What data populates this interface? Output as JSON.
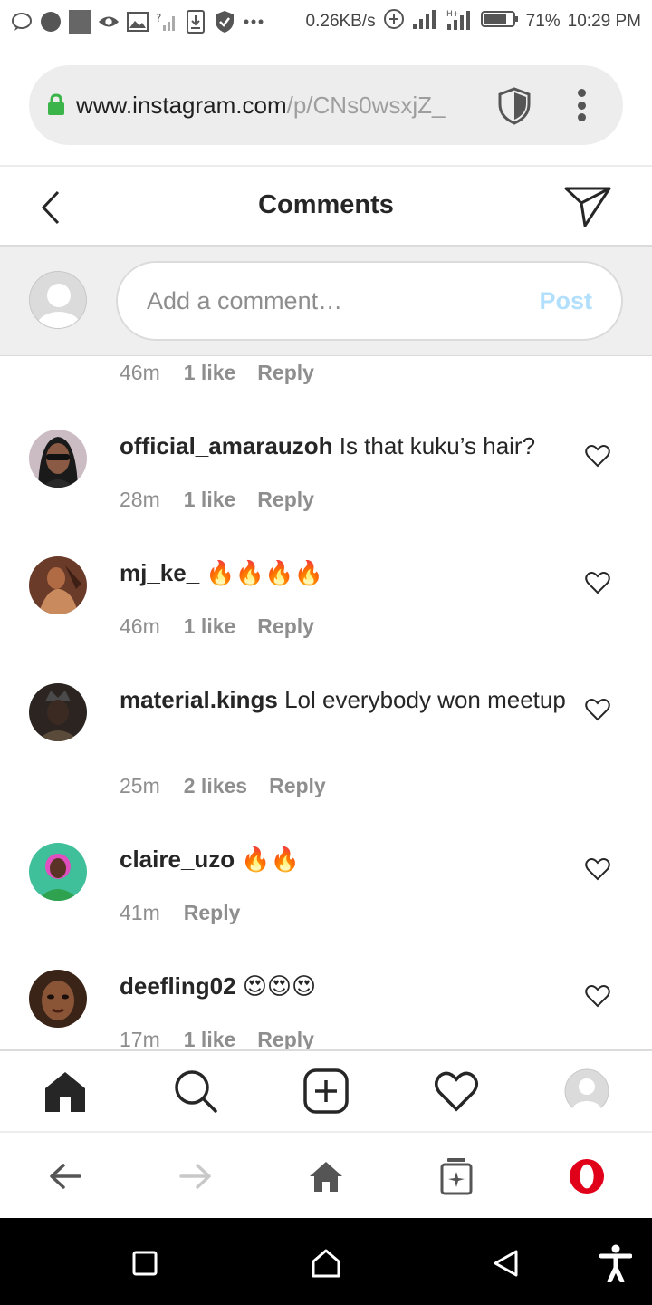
{
  "status_bar": {
    "network_speed": "0.26KB/s",
    "battery": "71%",
    "time": "10:29 PM"
  },
  "browser": {
    "url_domain": "www.instagram.com",
    "url_path": "/p/CNs0wsxjZ_"
  },
  "header": {
    "title": "Comments"
  },
  "composer": {
    "placeholder": "Add a comment…",
    "post_label": "Post"
  },
  "comments": [
    {
      "user": "",
      "text": "",
      "time": "46m",
      "likes": "1 like",
      "reply": "Reply"
    },
    {
      "user": "official_amarauzoh",
      "text": " Is that kuku’s hair?",
      "time": "28m",
      "likes": "1 like",
      "reply": "Reply"
    },
    {
      "user": "mj_ke_",
      "text": " 🔥🔥🔥🔥",
      "time": "46m",
      "likes": "1 like",
      "reply": "Reply"
    },
    {
      "user": "material.kings",
      "text": " Lol everybody won meetup",
      "time": "25m",
      "likes": "2 likes",
      "reply": "Reply"
    },
    {
      "user": "claire_uzo",
      "text": " 🔥🔥",
      "time": "41m",
      "likes": "",
      "reply": "Reply"
    },
    {
      "user": "deefling02",
      "text": " 😍😍😍",
      "time": "17m",
      "likes": "1 like",
      "reply": "Reply"
    }
  ],
  "icons": {
    "ig_nav": [
      "home-icon",
      "search-icon",
      "new-post-icon",
      "activity-heart-icon",
      "profile-icon"
    ],
    "browser_nav": [
      "back-arrow-icon",
      "forward-arrow-icon",
      "home-icon",
      "tabs-icon",
      "opera-icon"
    ],
    "android_nav": [
      "recents-square-icon",
      "home-circle-icon",
      "back-triangle-icon",
      "accessibility-icon"
    ]
  },
  "colors": {
    "post_disabled": "#b2dffc",
    "opera_red": "#e1001a",
    "lock_green": "#3bb54a"
  }
}
